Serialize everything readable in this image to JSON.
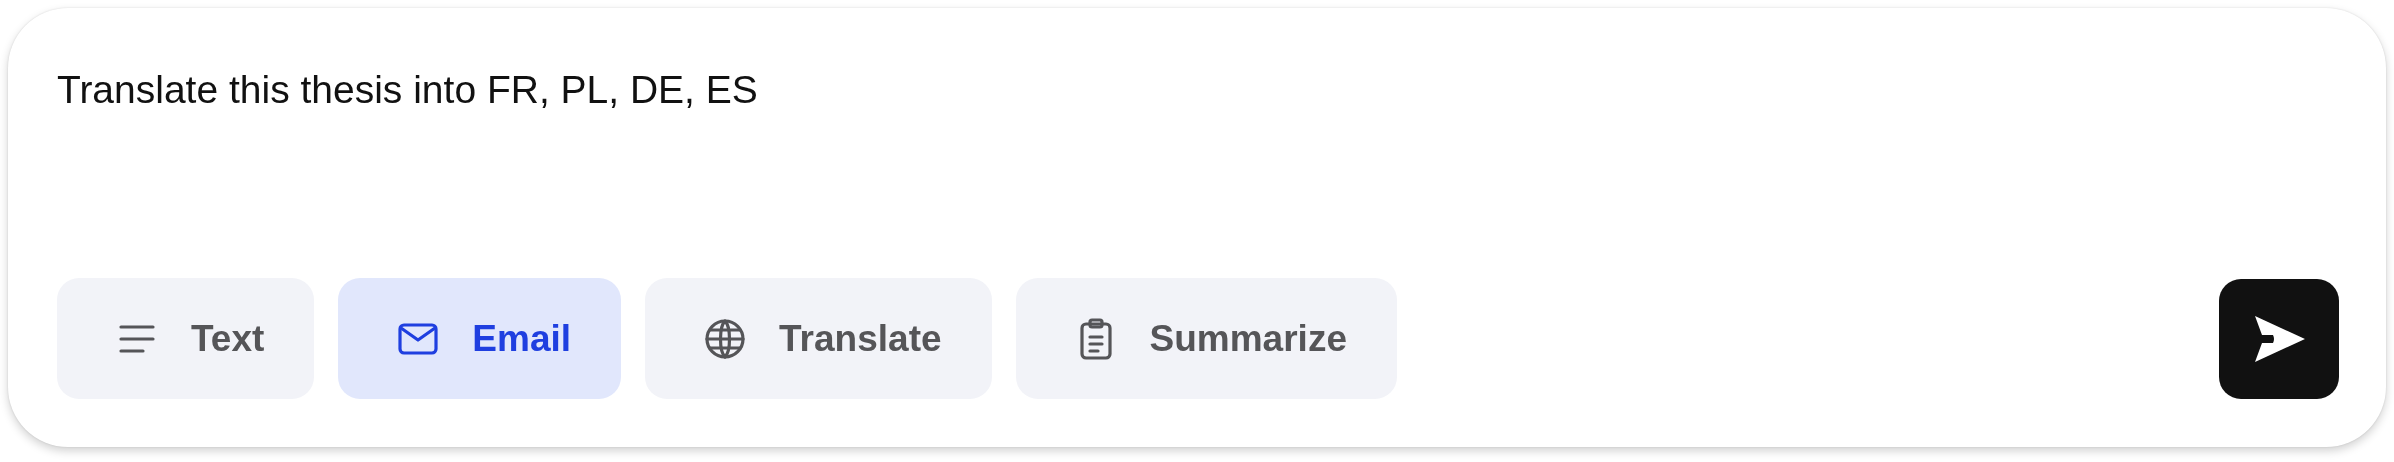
{
  "prompt": {
    "value": "Translate this thesis into FR, PL, DE, ES"
  },
  "chips": [
    {
      "kind": "text",
      "label": "Text",
      "selected": false
    },
    {
      "kind": "email",
      "label": "Email",
      "selected": true
    },
    {
      "kind": "translate",
      "label": "Translate",
      "selected": false
    },
    {
      "kind": "summarize",
      "label": "Summarize",
      "selected": false
    }
  ]
}
